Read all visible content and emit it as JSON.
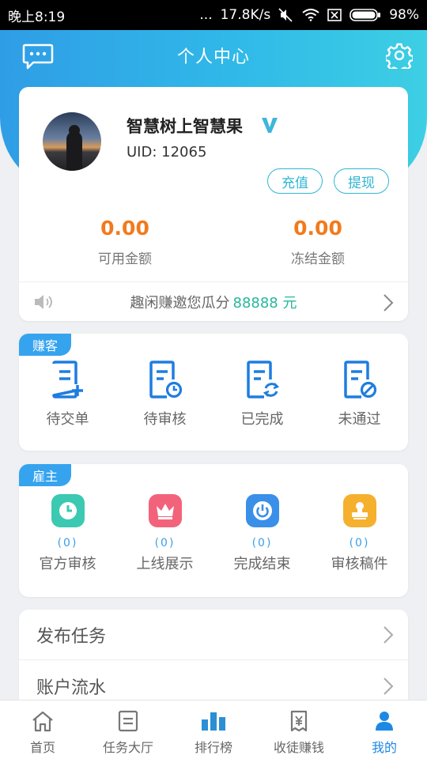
{
  "status_bar": {
    "time": "晚上8:19",
    "dots": "...",
    "speed": "17.8K/s",
    "battery": "98%"
  },
  "header": {
    "title": "个人中心",
    "accent": "#30b9e8"
  },
  "profile": {
    "username": "智慧树上智慧果",
    "uid": "UID: 12065",
    "recharge_label": "充值",
    "withdraw_label": "提现",
    "available_amount": "0.00",
    "available_label": "可用金额",
    "frozen_amount": "0.00",
    "frozen_label": "冻结金额",
    "notice_text": "趣闲赚邀您瓜分",
    "notice_amount": "88888 元"
  },
  "earner": {
    "tag": "赚客",
    "items": [
      {
        "label": "待交单",
        "icon": "doc-plus-icon"
      },
      {
        "label": "待审核",
        "icon": "doc-clock-icon"
      },
      {
        "label": "已完成",
        "icon": "doc-refresh-icon"
      },
      {
        "label": "未通过",
        "icon": "doc-ban-icon"
      }
    ]
  },
  "employer": {
    "tag": "雇主",
    "items": [
      {
        "label": "官方审核",
        "count": "(0)",
        "icon": "clock-icon",
        "color": "#3cc9b2"
      },
      {
        "label": "上线展示",
        "count": "(0)",
        "icon": "crown-icon",
        "color": "#f2637b"
      },
      {
        "label": "完成结束",
        "count": "(0)",
        "icon": "power-icon",
        "color": "#3a8fe8"
      },
      {
        "label": "审核稿件",
        "count": "(0)",
        "icon": "stamp-icon",
        "color": "#f5b02e"
      }
    ]
  },
  "menu": [
    {
      "label": "发布任务"
    },
    {
      "label": "账户流水"
    }
  ],
  "bottom_nav": [
    {
      "label": "首页",
      "icon": "home-icon"
    },
    {
      "label": "任务大厅",
      "icon": "task-list-icon"
    },
    {
      "label": "排行榜",
      "icon": "ranking-icon"
    },
    {
      "label": "收徒赚钱",
      "icon": "money-icon"
    },
    {
      "label": "我的",
      "icon": "user-icon",
      "active": true
    }
  ]
}
